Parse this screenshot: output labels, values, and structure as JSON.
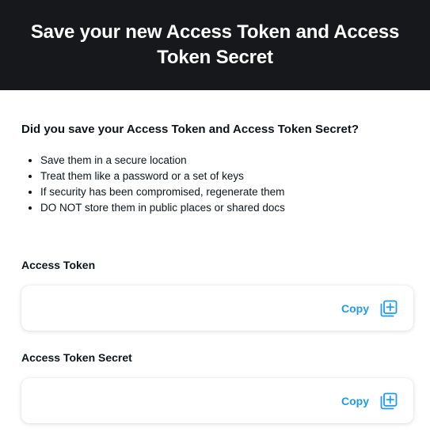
{
  "header": {
    "title": "Save your new Access Token and Access Token Secret"
  },
  "main": {
    "question": "Did you save your Access Token and Access Token Secret?",
    "tips": [
      "Save them in a secure location",
      "Treat them like a password or a set of keys",
      "If security has been compromised, regenerate them",
      "DO NOT store them in public places or shared docs"
    ]
  },
  "fields": {
    "access_token": {
      "label": "Access Token",
      "value": "",
      "copy_label": "Copy",
      "icon": "copy-icon"
    },
    "access_token_secret": {
      "label": "Access Token Secret",
      "value": "",
      "copy_label": "Copy",
      "icon": "copy-icon"
    }
  },
  "colors": {
    "header_bg": "#16181c",
    "accent": "#1d9bf0"
  }
}
